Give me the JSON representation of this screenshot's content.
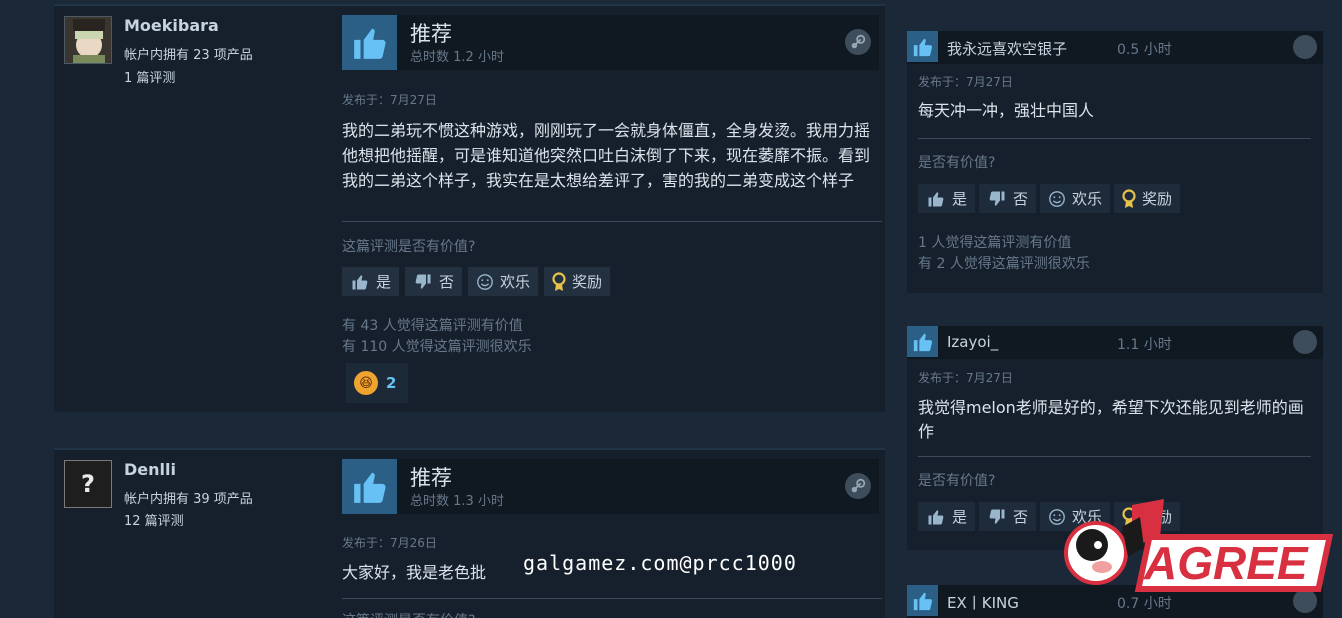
{
  "reviews": [
    {
      "username": "Moekibara",
      "products": "帐户内拥有 23 项产品",
      "review_count": "1 篇评测",
      "recommend": "推荐",
      "playtime": "总时数 1.2 小时",
      "date": "发布于：7月27日",
      "text": "我的二弟玩不惯这种游戏，刚刚玩了一会就身体僵直，全身发烫。我用力摇他想把他摇醒，可是谁知道他突然口吐白沫倒了下来，现在萎靡不振。看到我的二弟这个样子，我实在是太想给差评了，害的我的二弟变成这个样子",
      "helpful_q": "这篇评测是否有价值?",
      "btn_yes": "是",
      "btn_no": "否",
      "btn_funny": "欢乐",
      "btn_award": "奖励",
      "stat_helpful": "有 43 人觉得这篇评测有价值",
      "stat_funny": "有 110 人觉得这篇评测很欢乐",
      "award_count": "2"
    },
    {
      "username": "Denlli",
      "products": "帐户内拥有 39 项产品",
      "review_count": "12 篇评测",
      "recommend": "推荐",
      "playtime": "总时数 1.3 小时",
      "date": "发布于：7月26日",
      "text": "大家好，我是老色批",
      "helpful_q": "这篇评测是否有价值?"
    }
  ],
  "side_reviews": [
    {
      "name": "我永远喜欢空银子",
      "playtime": "0.5 小时",
      "date": "发布于：7月27日",
      "text": "每天冲一冲，强壮中国人",
      "question": "是否有价值?",
      "btn_yes": "是",
      "btn_no": "否",
      "btn_funny": "欢乐",
      "btn_award": "奖励",
      "stat_helpful": "1 人觉得这篇评测有价值",
      "stat_funny": "有 2 人觉得这篇评测很欢乐"
    },
    {
      "name": "Izayoi_",
      "playtime": "1.1 小时",
      "date": "发布于：7月27日",
      "text": "我觉得melon老师是好的，希望下次还能见到老师的画作",
      "question": "是否有价值?",
      "btn_yes": "是",
      "btn_no": "否",
      "btn_funny": "欢乐",
      "btn_award": "奖励"
    },
    {
      "name": "EX丨KING",
      "playtime": "0.7 小时"
    }
  ],
  "watermark": "galgamez.com@prcc1000",
  "logo_text": "AGREE",
  "colors": {
    "accent": "#67c1f5",
    "thumb_bg": "#2b5f86",
    "page_bg": "#1b2838",
    "card_bg": "#16202d"
  }
}
